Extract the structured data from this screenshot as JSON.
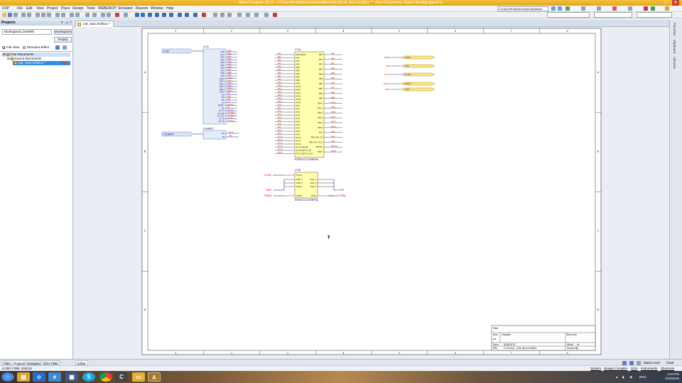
{
  "window": {
    "title": "Altium Designer (15.1) - C:\\Users\\Public\\Documents\\Altium\\AD15\\LM_Auto.SchDoc * - Free Documents. Robert Sterling signed in.",
    "buttons": {
      "minimize": "–",
      "maximize": "□",
      "close": "✕"
    }
  },
  "menu": {
    "items": [
      "DXP",
      "File",
      "Edit",
      "View",
      "Project",
      "Place",
      "Design",
      "Tools",
      "WEBENCH",
      "Simulator",
      "Reports",
      "Window",
      "Help"
    ],
    "path_value": "C:\\Users\\Public\\Documents\\Altium"
  },
  "projects_panel": {
    "title": "Projects",
    "workspace_combo": "Workspace1.DsnWrk",
    "workspace_button": "Workspace",
    "project_button": "Project",
    "view_options": [
      "File View",
      "Structure Editor"
    ],
    "selected_view": "File View",
    "tree": [
      {
        "label": "Free Documents",
        "level": 0,
        "state": "highlight"
      },
      {
        "label": "Source Documents",
        "level": 1,
        "state": "normal"
      },
      {
        "label": "LM_Auto.SchDoc *",
        "level": 2,
        "state": "selected"
      }
    ]
  },
  "doc_tab": {
    "label": "LM_Auto.SchDoc *"
  },
  "sheet": {
    "column_labels": [
      "1",
      "2",
      "3",
      "4",
      "5",
      "6",
      "7",
      "8"
    ],
    "row_labels": [
      "A",
      "B",
      "C",
      "D"
    ],
    "title_block": {
      "title_label": "Title",
      "size_label": "Size",
      "size_value": "A3",
      "number_label": "Number",
      "revision_label": "Revision",
      "date_label": "Date",
      "date_value": "4/16/2015",
      "sheet_label": "Sheet",
      "sheet_value": "of",
      "file_label": "File",
      "file_value": "C:\\Users\\...\\LM_Auto.SchDoc",
      "drawn_label": "Drawn By"
    }
  },
  "schematic": {
    "port_lcd": "LCD",
    "port_usart": "USART1",
    "lcd_block": {
      "title": "LCD",
      "pins": [
        "DB0",
        "DB1",
        "DB2",
        "DB3",
        "DB4",
        "DB5",
        "DB6",
        "DB7",
        "DB8",
        "DB9",
        "DB10",
        "DB11",
        "DB12",
        "DB13",
        "DB14",
        "DB15",
        "RS",
        "WR",
        "RD",
        "CS",
        "RESET",
        "BL",
        "TP_CS",
        "TP_IRQ",
        "TP_SCK",
        "TP_SI",
        "TP_SO"
      ]
    },
    "usart_block": {
      "title": "USART1",
      "pins": [
        "RX",
        "TX"
      ]
    },
    "mcu": {
      "designator": "U1A",
      "part": "STM32L152RBT6A",
      "left_pins": [
        "PA0-WKUP",
        "PA1",
        "PA2",
        "PA3",
        "PA4",
        "PA5",
        "PA6",
        "PA7",
        "PA8",
        "PA9",
        "PA10",
        "PA11",
        "PA12",
        "PA13",
        "PA14",
        "PA15",
        "PC0",
        "PC1",
        "PC2",
        "PC3",
        "PC4",
        "PC5",
        "PC6",
        "PC7",
        "PC8",
        "PC9",
        "PC10",
        "PC11",
        "PC12",
        "PC13-WKUP2",
        "PC14-OSC32_IN",
        "PC15-OSC32_OUT"
      ],
      "right_pins": [
        "PB0",
        "PB1",
        "PB2",
        "PB3",
        "PB4",
        "PB5",
        "PB6",
        "PB7",
        "PB8",
        "PB9",
        "PB10",
        "PB11",
        "PB12",
        "PB13",
        "PB14",
        "PB15",
        "PD2",
        "PH0-OSC_IN",
        "PH1-OSC_OUT",
        "BOOT0",
        "NRST"
      ]
    },
    "power_part": {
      "designator": "U1B",
      "part": "STM32L152RBT6A",
      "left_pins": [
        "VLCD",
        "VDD_1",
        "VDD_2",
        "VDD_3",
        "VDDA"
      ],
      "right_pins": [
        "VSS_1",
        "VSS_2",
        "VSS_3",
        "VSSA"
      ],
      "nets_left": [
        "VLCD",
        "VDD",
        "VDDA"
      ],
      "nets_right": [
        "VSS",
        "VSSA"
      ]
    },
    "net_labels_right": [
      {
        "left": "VSSA",
        "right": "VSSA"
      },
      {
        "left": "VSS",
        "right": "VSS"
      },
      {
        "left": "VLCD",
        "right": "VLCD"
      },
      {
        "left": "VDDA",
        "right": "VDDA"
      },
      {
        "left": "VDD",
        "right": "VDD"
      }
    ]
  },
  "right_strip": {
    "tabs": [
      "Favorites",
      "Clipboard",
      "Libraries"
    ]
  },
  "bottom_tabs": [
    "Files",
    "Projects",
    "Navigator",
    "SCH Filter"
  ],
  "active_bottom_tab": "Projects",
  "editor_tab": "Editor",
  "status": {
    "coords": "X:200 Y:290",
    "grid": "Grid:10",
    "right_items": [
      "System",
      "Design Compiler",
      "SCH",
      "Instruments",
      "Shortcuts"
    ],
    "mask": "Mask Level",
    "clear": "Clear"
  },
  "taskbar": {
    "apps": [
      "start-orb",
      "explorer",
      "outlook",
      "media",
      "skype",
      "chrome",
      "c",
      "notes",
      "altium"
    ],
    "active_app": "altium",
    "tray_lang": "ENG",
    "time": "3:43 PM",
    "date": "4/16/2015"
  },
  "colors": {
    "title_bar": "#f4c13b",
    "component_fill": "#ffffb0",
    "wire": "#000080",
    "net_red": "#c00000",
    "selection": "#2f8de4"
  }
}
